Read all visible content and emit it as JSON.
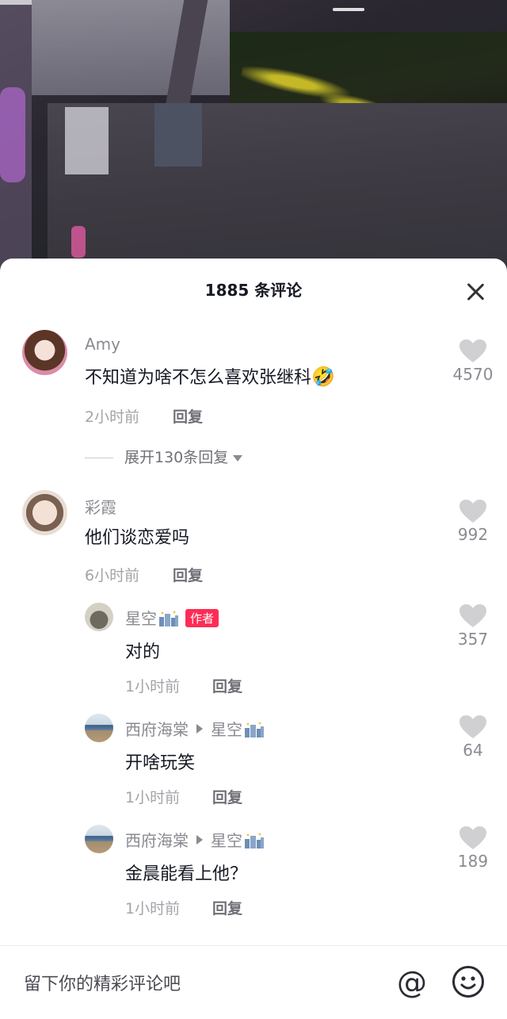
{
  "panel": {
    "title": "1885 条评论"
  },
  "comments": [
    {
      "user": "Amy",
      "text": "不知道为啥不怎么喜欢张继科",
      "emoji": "🤣",
      "time": "2小时前",
      "reply_label": "回复",
      "likes": "4570",
      "expand_label": "展开130条回复"
    },
    {
      "user": "彩霞",
      "text": "他们谈恋爱吗",
      "time": "6小时前",
      "reply_label": "回复",
      "likes": "992"
    }
  ],
  "replies": [
    {
      "user": "星空",
      "author_tag": "作者",
      "text": "对的",
      "time": "1小时前",
      "reply_label": "回复",
      "likes": "357"
    },
    {
      "user": "西府海棠",
      "reply_to": "星空",
      "text": "开啥玩笑",
      "time": "1小时前",
      "reply_label": "回复",
      "likes": "64"
    },
    {
      "user": "西府海棠",
      "reply_to": "星空",
      "text": "金晨能看上他？",
      "time": "1小时前",
      "reply_label": "回复",
      "likes": "189"
    }
  ],
  "input": {
    "placeholder": "留下你的精彩评论吧",
    "at_label": "@"
  },
  "colors": {
    "author_tag": "#fe2c55",
    "text_primary": "#161823",
    "text_secondary": "#8a8b91"
  },
  "icons": [
    "close-icon",
    "heart-icon",
    "city-emoji-icon",
    "reply-arrow-icon",
    "chevron-down-icon",
    "at-icon",
    "emoji-icon"
  ]
}
